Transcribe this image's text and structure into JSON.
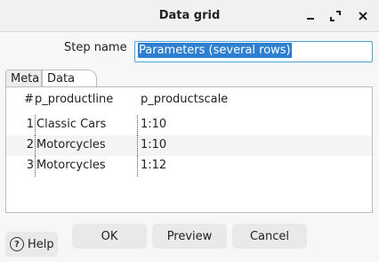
{
  "window": {
    "title": "Data grid",
    "minimize_symbol": "–",
    "maximize_symbol": "⤢",
    "close_symbol": "✕"
  },
  "form": {
    "step_name_label": "Step name",
    "step_name_value": "Parameters (several rows)"
  },
  "tabs": [
    {
      "label": "Meta",
      "active": false
    },
    {
      "label": "Data",
      "active": true
    }
  ],
  "grid": {
    "columns": [
      "#",
      "p_productline",
      "p_productscale"
    ],
    "rows": [
      {
        "num": "1",
        "productline": "Classic Cars",
        "productscale": "1:10"
      },
      {
        "num": "2",
        "productline": "Motorcycles",
        "productscale": "1:10"
      },
      {
        "num": "3",
        "productline": "Motorcycles",
        "productscale": "1:12"
      }
    ]
  },
  "buttons": {
    "help": "Help",
    "ok": "OK",
    "preview": "Preview",
    "cancel": "Cancel"
  },
  "icons": {
    "help": "help-circle-icon",
    "minimize": "minimize-icon",
    "maximize": "maximize-icon",
    "close": "close-icon"
  }
}
